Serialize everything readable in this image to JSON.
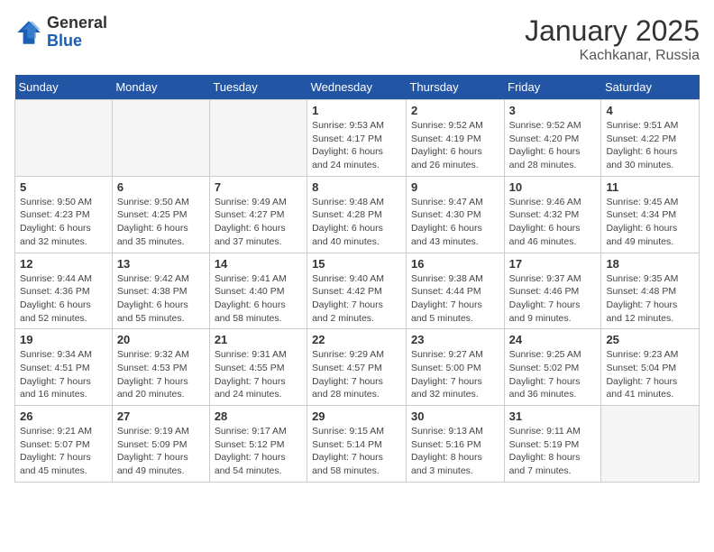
{
  "logo": {
    "general": "General",
    "blue": "Blue"
  },
  "title": "January 2025",
  "location": "Kachkanar, Russia",
  "days_header": [
    "Sunday",
    "Monday",
    "Tuesday",
    "Wednesday",
    "Thursday",
    "Friday",
    "Saturday"
  ],
  "weeks": [
    [
      {
        "day": "",
        "info": ""
      },
      {
        "day": "",
        "info": ""
      },
      {
        "day": "",
        "info": ""
      },
      {
        "day": "1",
        "info": "Sunrise: 9:53 AM\nSunset: 4:17 PM\nDaylight: 6 hours\nand 24 minutes."
      },
      {
        "day": "2",
        "info": "Sunrise: 9:52 AM\nSunset: 4:19 PM\nDaylight: 6 hours\nand 26 minutes."
      },
      {
        "day": "3",
        "info": "Sunrise: 9:52 AM\nSunset: 4:20 PM\nDaylight: 6 hours\nand 28 minutes."
      },
      {
        "day": "4",
        "info": "Sunrise: 9:51 AM\nSunset: 4:22 PM\nDaylight: 6 hours\nand 30 minutes."
      }
    ],
    [
      {
        "day": "5",
        "info": "Sunrise: 9:50 AM\nSunset: 4:23 PM\nDaylight: 6 hours\nand 32 minutes."
      },
      {
        "day": "6",
        "info": "Sunrise: 9:50 AM\nSunset: 4:25 PM\nDaylight: 6 hours\nand 35 minutes."
      },
      {
        "day": "7",
        "info": "Sunrise: 9:49 AM\nSunset: 4:27 PM\nDaylight: 6 hours\nand 37 minutes."
      },
      {
        "day": "8",
        "info": "Sunrise: 9:48 AM\nSunset: 4:28 PM\nDaylight: 6 hours\nand 40 minutes."
      },
      {
        "day": "9",
        "info": "Sunrise: 9:47 AM\nSunset: 4:30 PM\nDaylight: 6 hours\nand 43 minutes."
      },
      {
        "day": "10",
        "info": "Sunrise: 9:46 AM\nSunset: 4:32 PM\nDaylight: 6 hours\nand 46 minutes."
      },
      {
        "day": "11",
        "info": "Sunrise: 9:45 AM\nSunset: 4:34 PM\nDaylight: 6 hours\nand 49 minutes."
      }
    ],
    [
      {
        "day": "12",
        "info": "Sunrise: 9:44 AM\nSunset: 4:36 PM\nDaylight: 6 hours\nand 52 minutes."
      },
      {
        "day": "13",
        "info": "Sunrise: 9:42 AM\nSunset: 4:38 PM\nDaylight: 6 hours\nand 55 minutes."
      },
      {
        "day": "14",
        "info": "Sunrise: 9:41 AM\nSunset: 4:40 PM\nDaylight: 6 hours\nand 58 minutes."
      },
      {
        "day": "15",
        "info": "Sunrise: 9:40 AM\nSunset: 4:42 PM\nDaylight: 7 hours\nand 2 minutes."
      },
      {
        "day": "16",
        "info": "Sunrise: 9:38 AM\nSunset: 4:44 PM\nDaylight: 7 hours\nand 5 minutes."
      },
      {
        "day": "17",
        "info": "Sunrise: 9:37 AM\nSunset: 4:46 PM\nDaylight: 7 hours\nand 9 minutes."
      },
      {
        "day": "18",
        "info": "Sunrise: 9:35 AM\nSunset: 4:48 PM\nDaylight: 7 hours\nand 12 minutes."
      }
    ],
    [
      {
        "day": "19",
        "info": "Sunrise: 9:34 AM\nSunset: 4:51 PM\nDaylight: 7 hours\nand 16 minutes."
      },
      {
        "day": "20",
        "info": "Sunrise: 9:32 AM\nSunset: 4:53 PM\nDaylight: 7 hours\nand 20 minutes."
      },
      {
        "day": "21",
        "info": "Sunrise: 9:31 AM\nSunset: 4:55 PM\nDaylight: 7 hours\nand 24 minutes."
      },
      {
        "day": "22",
        "info": "Sunrise: 9:29 AM\nSunset: 4:57 PM\nDaylight: 7 hours\nand 28 minutes."
      },
      {
        "day": "23",
        "info": "Sunrise: 9:27 AM\nSunset: 5:00 PM\nDaylight: 7 hours\nand 32 minutes."
      },
      {
        "day": "24",
        "info": "Sunrise: 9:25 AM\nSunset: 5:02 PM\nDaylight: 7 hours\nand 36 minutes."
      },
      {
        "day": "25",
        "info": "Sunrise: 9:23 AM\nSunset: 5:04 PM\nDaylight: 7 hours\nand 41 minutes."
      }
    ],
    [
      {
        "day": "26",
        "info": "Sunrise: 9:21 AM\nSunset: 5:07 PM\nDaylight: 7 hours\nand 45 minutes."
      },
      {
        "day": "27",
        "info": "Sunrise: 9:19 AM\nSunset: 5:09 PM\nDaylight: 7 hours\nand 49 minutes."
      },
      {
        "day": "28",
        "info": "Sunrise: 9:17 AM\nSunset: 5:12 PM\nDaylight: 7 hours\nand 54 minutes."
      },
      {
        "day": "29",
        "info": "Sunrise: 9:15 AM\nSunset: 5:14 PM\nDaylight: 7 hours\nand 58 minutes."
      },
      {
        "day": "30",
        "info": "Sunrise: 9:13 AM\nSunset: 5:16 PM\nDaylight: 8 hours\nand 3 minutes."
      },
      {
        "day": "31",
        "info": "Sunrise: 9:11 AM\nSunset: 5:19 PM\nDaylight: 8 hours\nand 7 minutes."
      },
      {
        "day": "",
        "info": ""
      }
    ]
  ]
}
